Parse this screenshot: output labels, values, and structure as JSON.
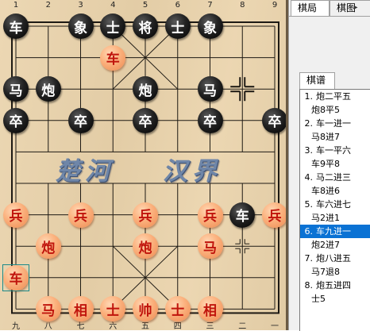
{
  "board": {
    "file_numbers_top": [
      "1",
      "2",
      "3",
      "4",
      "5",
      "6",
      "7",
      "8",
      "9"
    ],
    "file_numbers_bottom": [
      "九",
      "八",
      "七",
      "六",
      "五",
      "四",
      "三",
      "二",
      "一"
    ],
    "river_left": "楚河",
    "river_right": "汉界",
    "pieces": [
      {
        "side": "black",
        "char": "车",
        "file": 1,
        "rank": 1
      },
      {
        "side": "black",
        "char": "象",
        "file": 3,
        "rank": 1
      },
      {
        "side": "black",
        "char": "士",
        "file": 4,
        "rank": 1
      },
      {
        "side": "black",
        "char": "将",
        "file": 5,
        "rank": 1
      },
      {
        "side": "black",
        "char": "士",
        "file": 6,
        "rank": 1
      },
      {
        "side": "black",
        "char": "象",
        "file": 7,
        "rank": 1
      },
      {
        "side": "red",
        "char": "车",
        "file": 4,
        "rank": 2
      },
      {
        "side": "black",
        "char": "马",
        "file": 1,
        "rank": 3
      },
      {
        "side": "black",
        "char": "炮",
        "file": 2,
        "rank": 3
      },
      {
        "side": "black",
        "char": "炮",
        "file": 5,
        "rank": 3
      },
      {
        "side": "black",
        "char": "马",
        "file": 7,
        "rank": 3
      },
      {
        "side": "black",
        "char": "卒",
        "file": 1,
        "rank": 4
      },
      {
        "side": "black",
        "char": "卒",
        "file": 3,
        "rank": 4
      },
      {
        "side": "black",
        "char": "卒",
        "file": 5,
        "rank": 4
      },
      {
        "side": "black",
        "char": "卒",
        "file": 7,
        "rank": 4
      },
      {
        "side": "black",
        "char": "卒",
        "file": 9,
        "rank": 4
      },
      {
        "side": "red",
        "char": "兵",
        "file": 1,
        "rank": 7
      },
      {
        "side": "red",
        "char": "兵",
        "file": 3,
        "rank": 7
      },
      {
        "side": "red",
        "char": "兵",
        "file": 5,
        "rank": 7
      },
      {
        "side": "red",
        "char": "兵",
        "file": 7,
        "rank": 7
      },
      {
        "side": "black",
        "char": "车",
        "file": 8,
        "rank": 7
      },
      {
        "side": "red",
        "char": "兵",
        "file": 9,
        "rank": 7
      },
      {
        "side": "red",
        "char": "炮",
        "file": 2,
        "rank": 8
      },
      {
        "side": "red",
        "char": "炮",
        "file": 5,
        "rank": 8
      },
      {
        "side": "red",
        "char": "马",
        "file": 7,
        "rank": 8
      },
      {
        "side": "red",
        "char": "车",
        "file": 1,
        "rank": 9
      },
      {
        "side": "red",
        "char": "马",
        "file": 2,
        "rank": 10
      },
      {
        "side": "red",
        "char": "相",
        "file": 3,
        "rank": 10
      },
      {
        "side": "red",
        "char": "士",
        "file": 4,
        "rank": 10
      },
      {
        "side": "red",
        "char": "帅",
        "file": 5,
        "rank": 10
      },
      {
        "side": "red",
        "char": "士",
        "file": 6,
        "rank": 10
      },
      {
        "side": "red",
        "char": "相",
        "file": 7,
        "rank": 10
      }
    ],
    "selected": {
      "file": 1,
      "rank": 9
    },
    "last_move_origin": {
      "file": 8,
      "rank": 3
    }
  },
  "panel": {
    "tab_board": "棋局",
    "tab_diagram": "棋图",
    "tab_record": "棋谱",
    "moves": [
      {
        "num": "1.",
        "red": "炮二平五",
        "black": "炮8平5"
      },
      {
        "num": "2.",
        "red": "车一进一",
        "black": "马8进7"
      },
      {
        "num": "3.",
        "red": "车一平六",
        "black": "车9平8"
      },
      {
        "num": "4.",
        "red": "马二进三",
        "black": "车8进6"
      },
      {
        "num": "5.",
        "red": "车六进七",
        "black": "马2进1"
      },
      {
        "num": "6.",
        "red": "车九进一",
        "black": "炮2进7"
      },
      {
        "num": "7.",
        "red": "炮八进五",
        "black": "马7退8"
      },
      {
        "num": "8.",
        "red": "炮五进四",
        "black": "士5"
      }
    ],
    "selected_move_index": 5
  },
  "colors": {
    "board": "#ead3ab",
    "grid": "#1e1a14",
    "red_piece_text": "#c0140c",
    "black_piece_bg": "#111111",
    "selection": "#0a72d4"
  }
}
